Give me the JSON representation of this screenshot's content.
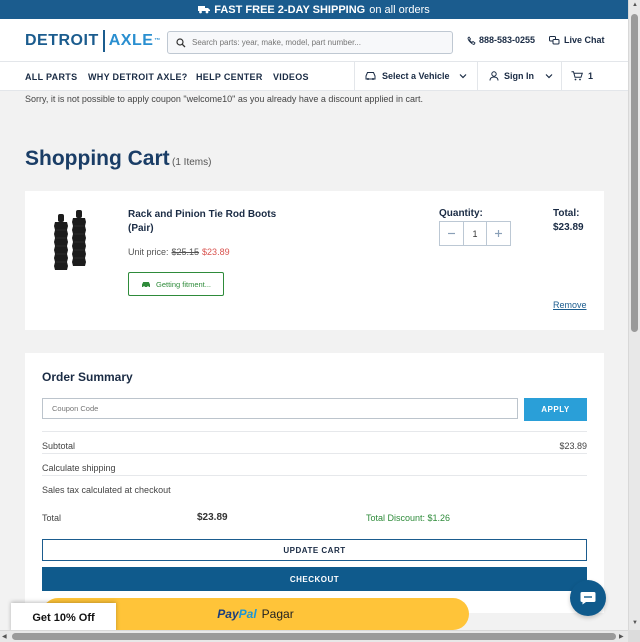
{
  "promo": {
    "truck_icon": "truck-icon",
    "bold": "FAST FREE 2-DAY SHIPPING",
    "rest": "on all orders"
  },
  "header": {
    "logo_detroit": "DETROIT",
    "logo_axle": "AXLE",
    "logo_tm": "™",
    "search_placeholder": "Search parts: year, make, model, part number...",
    "phone": "888-583-0255",
    "live_chat": "Live Chat"
  },
  "nav": {
    "items": [
      "ALL PARTS",
      "WHY DETROIT AXLE?",
      "HELP CENTER",
      "VIDEOS"
    ],
    "select_vehicle": "Select a Vehicle",
    "sign_in": "Sign In",
    "cart_count": "1"
  },
  "notice": "Sorry, it is not possible to apply coupon \"welcome10\" as you already have a discount applied in cart.",
  "cart": {
    "title": "Shopping Cart",
    "items_count": "(1 Items)",
    "product": {
      "name": "Rack and Pinion Tie Rod Boots (Pair)",
      "unit_price_label": "Unit price:",
      "old_price": "$25.15",
      "new_price": "$23.89",
      "fitment": "Getting fitment...",
      "quantity_label": "Quantity:",
      "quantity": "1",
      "total_label": "Total:",
      "total": "$23.89",
      "remove": "Remove"
    }
  },
  "summary": {
    "title": "Order Summary",
    "coupon_placeholder": "Coupon Code",
    "apply": "APPLY",
    "subtotal_label": "Subtotal",
    "subtotal": "$23.89",
    "shipping_label": "Calculate shipping",
    "tax_label": "Sales tax calculated at checkout",
    "total_label": "Total",
    "total": "$23.89",
    "discount": "Total Discount: $1.26",
    "update_cart": "UPDATE CART",
    "checkout": "CHECKOUT"
  },
  "paypal": {
    "pay": "Pay",
    "pal": "Pal",
    "pagar": "Pagar"
  },
  "get_off": "Get 10% Off",
  "colors": {
    "brand": "#1b5c8e",
    "accent": "#2a9fd8",
    "sale": "#d9534f",
    "success": "#2e8b3a",
    "paypal": "#ffc439"
  }
}
